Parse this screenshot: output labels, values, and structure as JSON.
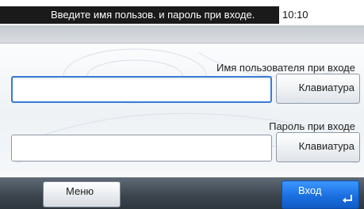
{
  "header": {
    "message": "Введите имя пользов. и пароль при входе.",
    "time": "10:10"
  },
  "login": {
    "username_label": "Имя пользователя при входе",
    "username_value": "",
    "password_label": "Пароль при входе",
    "password_value": "",
    "keyboard_button": "Клавиатура"
  },
  "footer": {
    "menu_button": "Меню",
    "login_button": "Вход"
  },
  "icons": {
    "enter": "enter-arrow-icon"
  },
  "colors": {
    "accent": "#1b6fe0",
    "focus": "#3a7bd5",
    "header_bg": "#1a1a1a",
    "footer_bg": "#3b444d"
  }
}
